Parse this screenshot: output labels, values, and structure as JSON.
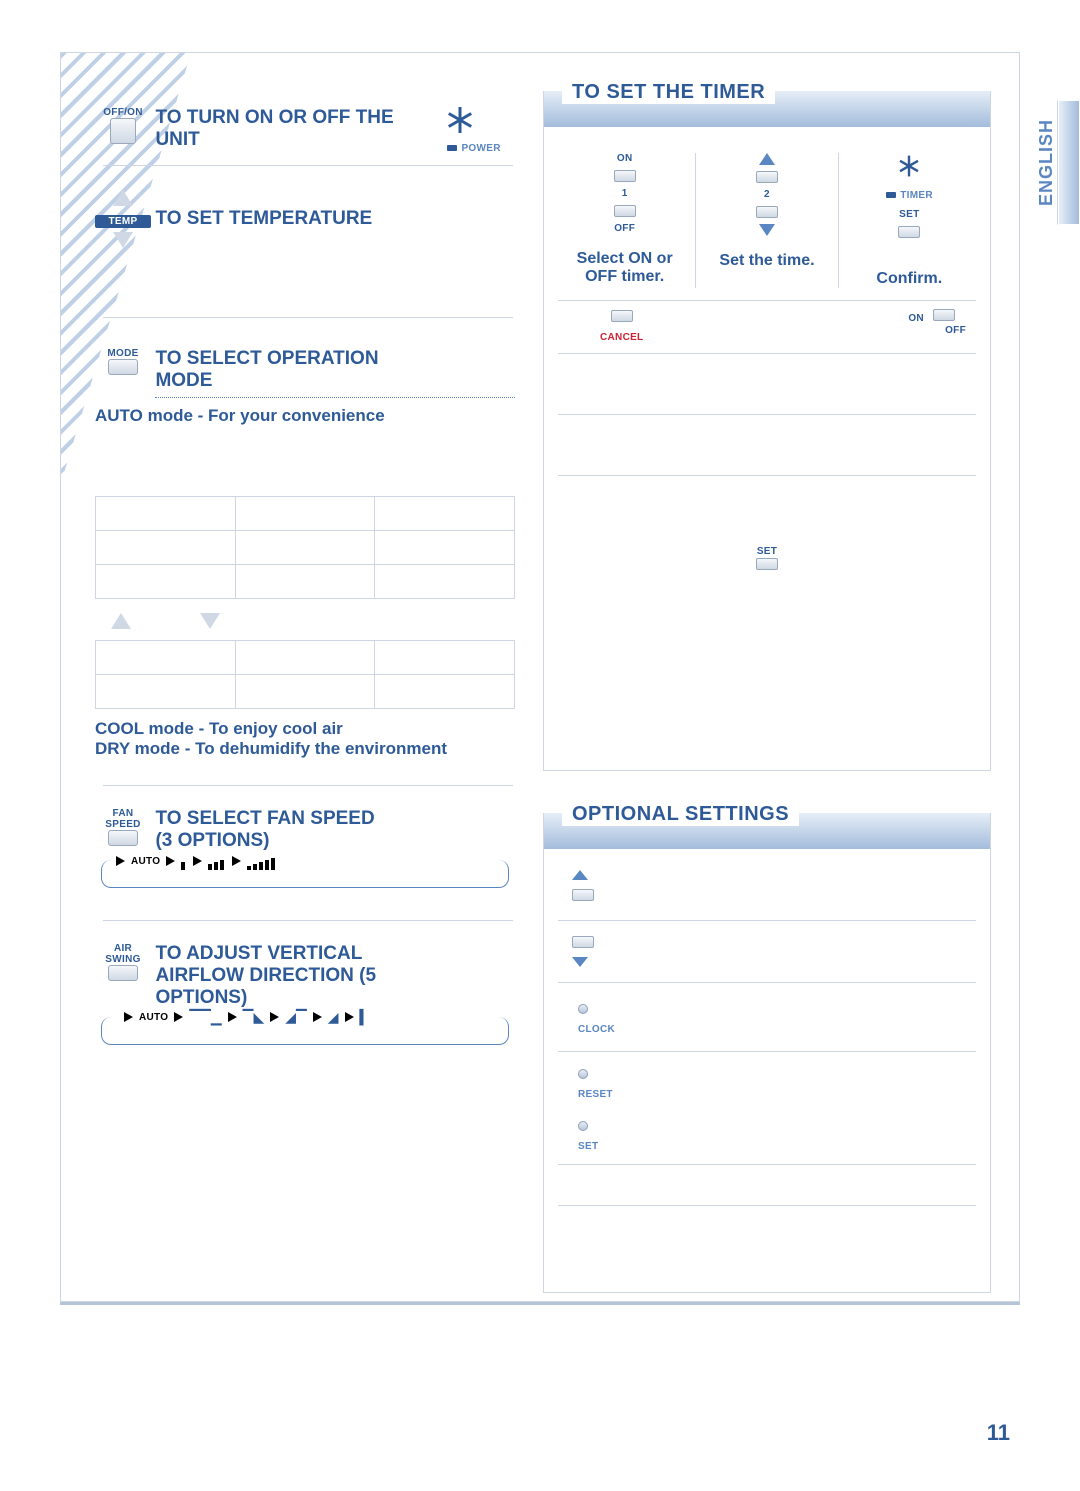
{
  "page_number": "11",
  "language_tab": "ENGLISH",
  "left": {
    "power": {
      "btn_label": "OFF/ON",
      "title": "TO TURN ON OR OFF THE UNIT",
      "indicator": "POWER"
    },
    "temp": {
      "btn_label": "TEMP",
      "title": "TO SET TEMPERATURE"
    },
    "mode": {
      "btn_label": "MODE",
      "title": "TO SELECT OPERATION MODE",
      "auto": "AUTO mode - For your convenience",
      "cool": "COOL mode - To enjoy cool air",
      "dry": "DRY mode - To dehumidify the environment"
    },
    "fan": {
      "btn_label": "FAN SPEED",
      "title": "TO SELECT FAN SPEED",
      "subtitle": "(3 OPTIONS)",
      "cycle_start": "AUTO"
    },
    "airswing": {
      "btn_label": "AIR SWING",
      "title": "TO ADJUST VERTICAL AIRFLOW DIRECTION  (5 OPTIONS)",
      "cycle_start": "AUTO"
    }
  },
  "timer": {
    "title": "TO SET THE TIMER",
    "col1": {
      "on": "ON",
      "num": "1",
      "off": "OFF",
      "caption": "Select ON or OFF timer."
    },
    "col2": {
      "num": "2",
      "caption": "Set the time."
    },
    "col3": {
      "indicator": "TIMER",
      "set": "SET",
      "caption": "Confirm."
    },
    "cancel": "CANCEL",
    "onoff": {
      "on": "ON",
      "off": "OFF"
    },
    "set_btn": "SET"
  },
  "optional": {
    "title": "OPTIONAL SETTINGS",
    "clock": "CLOCK",
    "reset": "RESET",
    "set": "SET"
  }
}
